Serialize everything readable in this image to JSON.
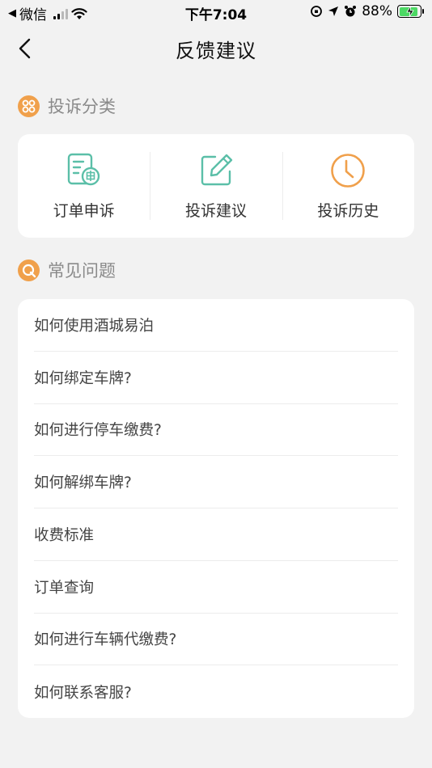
{
  "status_bar": {
    "back_app": "微信",
    "time": "下午7:04",
    "battery": "88%"
  },
  "nav": {
    "title": "反馈建议"
  },
  "complaint_section": {
    "title": "投诉分类",
    "items": [
      {
        "label": "订单申诉",
        "icon": "order-appeal-icon"
      },
      {
        "label": "投诉建议",
        "icon": "edit-icon"
      },
      {
        "label": "投诉历史",
        "icon": "clock-icon"
      }
    ]
  },
  "faq_section": {
    "title": "常见问题",
    "items": [
      "如何使用酒城易泊",
      "如何绑定车牌?",
      "如何进行停车缴费?",
      "如何解绑车牌?",
      "收费标准",
      "订单查询",
      "如何进行车辆代缴费?",
      "如何联系客服?"
    ]
  },
  "colors": {
    "accent_orange": "#f0a04b",
    "icon_teal": "#5bbfa8",
    "background": "#f2f2f2"
  }
}
